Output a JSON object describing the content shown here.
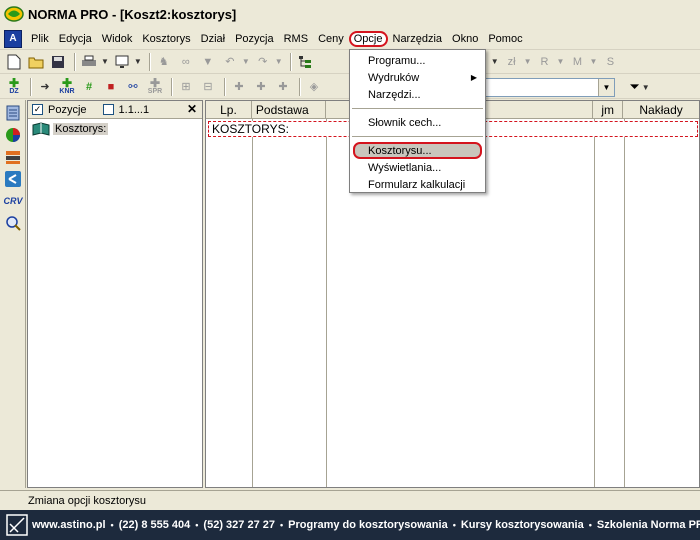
{
  "window": {
    "title": "NORMA PRO - [Koszt2:kosztorys]"
  },
  "menubar": {
    "items": [
      {
        "label": "Plik"
      },
      {
        "label": "Edycja"
      },
      {
        "label": "Widok"
      },
      {
        "label": "Kosztorys"
      },
      {
        "label": "Dział"
      },
      {
        "label": "Pozycja"
      },
      {
        "label": "RMS"
      },
      {
        "label": "Ceny"
      },
      {
        "label": "Opcje"
      },
      {
        "label": "Narzędzia"
      },
      {
        "label": "Okno"
      },
      {
        "label": "Pomoc"
      }
    ],
    "active": "Opcje"
  },
  "toolbar1": {
    "icons": [
      "new-document-icon",
      "open-folder-icon",
      "save-icon",
      "print-icon",
      "monitor-icon",
      "find-icon",
      "glasses-icon",
      "filter-icon",
      "undo-icon",
      "redo-icon",
      "tree-icon",
      "calculator-icon",
      "percent-icon",
      "table-icon",
      "currency-icon",
      "r-icon",
      "m-icon",
      "s-icon"
    ],
    "percent_label": "+%"
  },
  "toolbar2": {
    "icons": [
      "add-dz-icon",
      "goto-icon",
      "knr-icon",
      "hash-icon",
      "truck-icon",
      "sitemap-icon",
      "spr-icon",
      "tree-expand-icon",
      "tree-collapse-icon",
      "add-item-icon",
      "add-sub-icon",
      "add-calc-icon",
      "rms-icon"
    ],
    "dz_label": "DZ",
    "knr_label": "KNR",
    "spr_label": "SPR"
  },
  "leftstrip": {
    "icons": [
      "calendar-icon",
      "pie-chart-icon",
      "layers-icon",
      "share-icon",
      "crv-icon",
      "zoom-icon"
    ],
    "crv_label": "CRV"
  },
  "tree": {
    "header": {
      "pozycje_label": "Pozycje",
      "range_label": "1.1...1",
      "close_label": "✕",
      "pozycje_checked": "✓"
    },
    "root": "Kosztorys:"
  },
  "grid": {
    "columns": [
      "Lp.",
      "Podstawa",
      "jm",
      "Nakłady"
    ],
    "row": "KOSZTORYS:"
  },
  "dropdown": {
    "items": [
      {
        "label": "Programu...",
        "has_sub": false
      },
      {
        "label": "Wydruków",
        "has_sub": true
      },
      {
        "label": "Narzędzi...",
        "has_sub": false
      },
      {
        "label": "Słownik cech...",
        "has_sub": false
      },
      {
        "label": "Kosztorysu...",
        "has_sub": false
      },
      {
        "label": "Wyświetlania...",
        "has_sub": false
      },
      {
        "label": "Formularz kalkulacji",
        "has_sub": false
      }
    ],
    "highlighted": "Kosztorysu..."
  },
  "status": {
    "text": "Zmiana opcji kosztorysu"
  },
  "footer": {
    "items": [
      "www.astino.pl",
      "(22) 8 555 404",
      "(52) 327 27 27",
      "Programy do kosztorysowania",
      "Kursy kosztorysowania",
      "Szkolenia Norma PRO"
    ],
    "separator": "•"
  },
  "colors": {
    "highlight_red": "#d4141e",
    "footer_bg": "#1d2a3d",
    "xp_face": "#ece9d8"
  }
}
